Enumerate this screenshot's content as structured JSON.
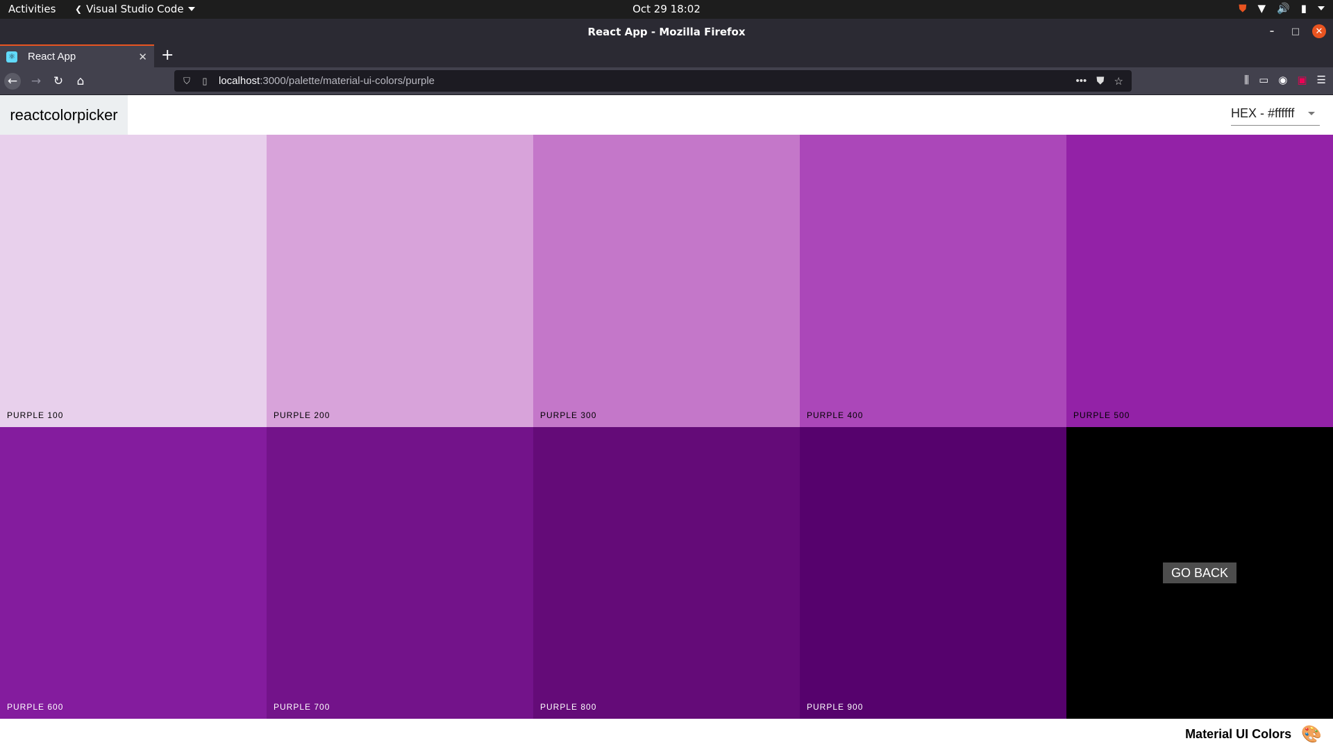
{
  "system_bar": {
    "activities": "Activities",
    "app_name": "Visual Studio Code",
    "clock": "Oct 29  18:02"
  },
  "window": {
    "title": "React App - Mozilla Firefox",
    "minimize": "–",
    "maximize": "□",
    "close": "✕"
  },
  "tabs": [
    {
      "label": "React App",
      "favicon": "⚛"
    }
  ],
  "browser": {
    "url_host": "localhost",
    "url_path": ":3000/palette/material-ui-colors/purple"
  },
  "app": {
    "logo": "reactcolorpicker",
    "format_value": "HEX - #ffffff",
    "swatches": [
      {
        "name": "PURPLE 100",
        "color": "#e8d0ec",
        "text": "lite"
      },
      {
        "name": "PURPLE 200",
        "color": "#d8a3da",
        "text": "lite"
      },
      {
        "name": "PURPLE 300",
        "color": "#c477c9",
        "text": "lite"
      },
      {
        "name": "PURPLE 400",
        "color": "#ab47b9",
        "text": "lite"
      },
      {
        "name": "PURPLE 500",
        "color": "#9322a7",
        "text": "lite"
      },
      {
        "name": "PURPLE 600",
        "color": "#841c9e",
        "text": "dark"
      },
      {
        "name": "PURPLE 700",
        "color": "#73138a",
        "text": "dark"
      },
      {
        "name": "PURPLE 800",
        "color": "#640b78",
        "text": "dark"
      },
      {
        "name": "PURPLE 900",
        "color": "#56026d",
        "text": "dark"
      }
    ],
    "go_back": "GO BACK",
    "footer_name": "Material UI Colors",
    "footer_emoji": "🎨"
  }
}
